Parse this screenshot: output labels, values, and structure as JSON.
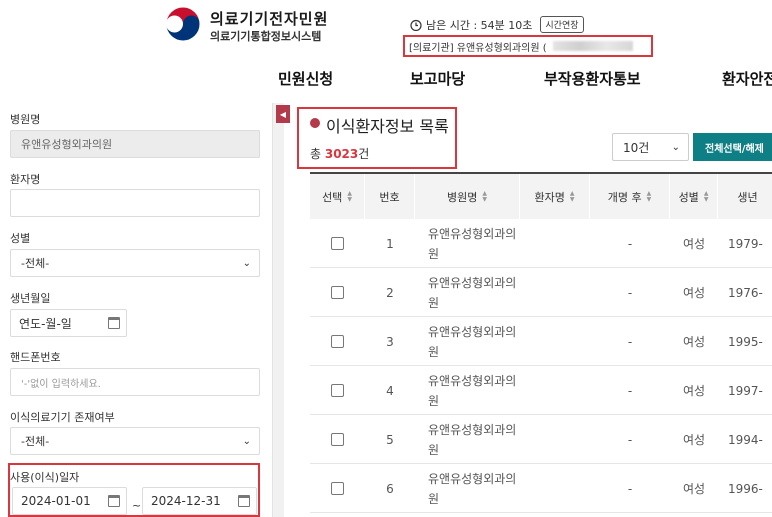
{
  "header": {
    "brand_title": "의료기기전자민원",
    "brand_subtitle": "의료기기통합정보시스템",
    "remaining_time": "남은 시간 : 54분 10초",
    "extend_label": "시간연장",
    "institution": "[의료기관] 유앤유성형외과의원 ("
  },
  "nav": {
    "items": [
      "민원신청",
      "보고마당",
      "부작용환자통보",
      "환자안전"
    ]
  },
  "sidebar": {
    "hospital_label": "병원명",
    "hospital_value": "유앤유성형외과의원",
    "patient_label": "환자명",
    "patient_value": "",
    "gender_label": "성별",
    "gender_value": "-전체-",
    "birth_label": "생년월일",
    "birth_value": "연도-월-일",
    "phone_label": "핸드폰번호",
    "phone_placeholder": "'-'없이 입력하세요.",
    "implant_label": "이식의료기기 존재여부",
    "implant_value": "-전체-",
    "use_date_label": "사용(이식)일자",
    "date_from": "2024-01-01",
    "date_to": "2024-12-31",
    "tilde": "~"
  },
  "main": {
    "list_title": "이식환자정보 목록",
    "count_prefix": "총 ",
    "count_value": "3023",
    "count_suffix": "건",
    "page_size": "10건",
    "select_all_label": "전체선택/해제"
  },
  "table": {
    "columns": [
      "선택",
      "번호",
      "병원명",
      "환자명",
      "개명 후",
      "성별",
      "생년"
    ],
    "rows": [
      {
        "no": "1",
        "hospital": "유앤유성형외과의원",
        "rename": "-",
        "gender": "여성",
        "birth": "1979-"
      },
      {
        "no": "2",
        "hospital": "유앤유성형외과의원",
        "rename": "-",
        "gender": "여성",
        "birth": "1976-"
      },
      {
        "no": "3",
        "hospital": "유앤유성형외과의원",
        "rename": "-",
        "gender": "여성",
        "birth": "1995-"
      },
      {
        "no": "4",
        "hospital": "유앤유성형외과의원",
        "rename": "-",
        "gender": "여성",
        "birth": "1997-"
      },
      {
        "no": "5",
        "hospital": "유앤유성형외과의원",
        "rename": "-",
        "gender": "여성",
        "birth": "1994-"
      },
      {
        "no": "6",
        "hospital": "유앤유성형외과의원",
        "rename": "-",
        "gender": "여성",
        "birth": "1996-"
      }
    ]
  },
  "colors": {
    "accent_red": "#d9363e",
    "brand_maroon": "#b33a4a",
    "teal_button": "#0f7f86"
  }
}
